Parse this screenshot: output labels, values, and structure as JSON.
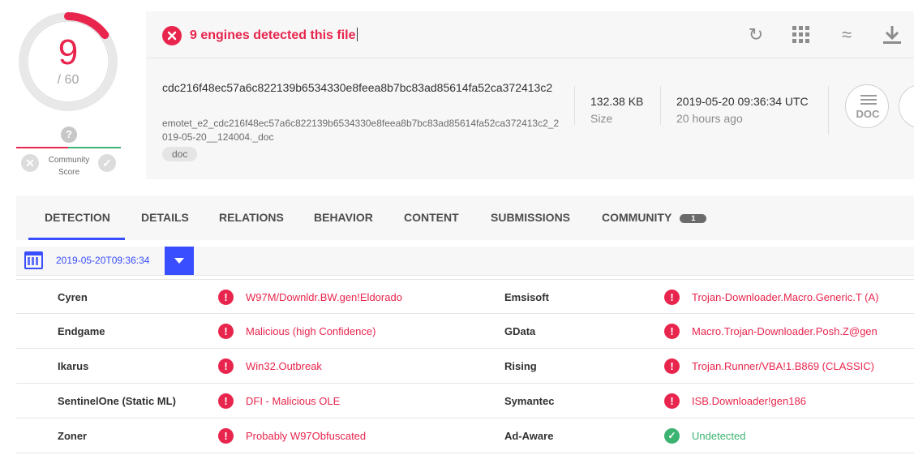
{
  "score": {
    "detected": "9",
    "total": "/ 60"
  },
  "community": {
    "question": "?",
    "label": "Community\nScore"
  },
  "header": {
    "detection_text": "9 engines detected this file",
    "hash": "cdc216f48ec57a6c822139b6534330e8feea8b7bc83ad85614fa52ca372413c2",
    "filename": "emotet_e2_cdc216f48ec57a6c822139b6534330e8feea8b7bc83ad85614fa52ca372413c2_2019-05-20__124004._doc",
    "tag": "doc",
    "size_value": "132.38 KB",
    "size_label": "Size",
    "date_value": "2019-05-20 09:36:34 UTC",
    "date_ago": "20 hours ago",
    "file_type": "DOC"
  },
  "toolbar": {
    "reanalyze_icon": "↻",
    "qr_icon": "▦",
    "similar_icon": "≈",
    "download_icon": "⤓"
  },
  "tabs": [
    {
      "label": "DETECTION"
    },
    {
      "label": "DETAILS"
    },
    {
      "label": "RELATIONS"
    },
    {
      "label": "BEHAVIOR"
    },
    {
      "label": "CONTENT"
    },
    {
      "label": "SUBMISSIONS"
    },
    {
      "label": "COMMUNITY",
      "badge": "1"
    }
  ],
  "analysis_date": "2019-05-20T09:36:34",
  "colors": {
    "malicious": "#e8254d",
    "undetected": "#3cb371",
    "accent": "#394eff"
  },
  "results": [
    {
      "left": {
        "engine": "Cyren",
        "result": "W97M/Downldr.BW.gen!Eldorado",
        "status": "malicious"
      },
      "right": {
        "engine": "Emsisoft",
        "result": "Trojan-Downloader.Macro.Generic.T (A)",
        "status": "malicious"
      }
    },
    {
      "left": {
        "engine": "Endgame",
        "result": "Malicious (high Confidence)",
        "status": "malicious"
      },
      "right": {
        "engine": "GData",
        "result": "Macro.Trojan-Downloader.Posh.Z@gen",
        "status": "malicious"
      }
    },
    {
      "left": {
        "engine": "Ikarus",
        "result": "Win32.Outbreak",
        "status": "malicious"
      },
      "right": {
        "engine": "Rising",
        "result": "Trojan.Runner/VBA!1.B869 (CLASSIC)",
        "status": "malicious"
      }
    },
    {
      "left": {
        "engine": "SentinelOne (Static ML)",
        "result": "DFI - Malicious OLE",
        "status": "malicious"
      },
      "right": {
        "engine": "Symantec",
        "result": "ISB.Downloader!gen186",
        "status": "malicious"
      }
    },
    {
      "left": {
        "engine": "Zoner",
        "result": "Probably W97Obfuscated",
        "status": "malicious"
      },
      "right": {
        "engine": "Ad-Aware",
        "result": "Undetected",
        "status": "undetected"
      }
    }
  ]
}
